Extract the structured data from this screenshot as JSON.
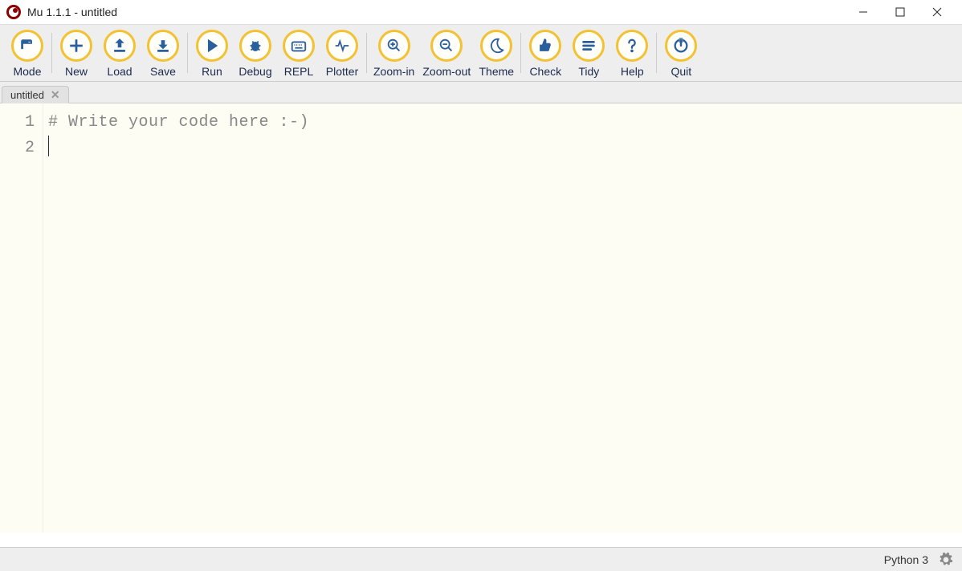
{
  "titlebar": {
    "app_title": "Mu 1.1.1 - untitled"
  },
  "toolbar": {
    "groups": [
      {
        "items": [
          {
            "id": "mode",
            "label": "Mode",
            "icon": "mode-icon"
          }
        ]
      },
      {
        "items": [
          {
            "id": "new",
            "label": "New",
            "icon": "plus-icon"
          },
          {
            "id": "load",
            "label": "Load",
            "icon": "upload-icon"
          },
          {
            "id": "save",
            "label": "Save",
            "icon": "download-icon"
          }
        ]
      },
      {
        "items": [
          {
            "id": "run",
            "label": "Run",
            "icon": "play-icon"
          },
          {
            "id": "debug",
            "label": "Debug",
            "icon": "bug-icon"
          },
          {
            "id": "repl",
            "label": "REPL",
            "icon": "keyboard-icon"
          },
          {
            "id": "plotter",
            "label": "Plotter",
            "icon": "pulse-icon"
          }
        ]
      },
      {
        "items": [
          {
            "id": "zoom-in",
            "label": "Zoom-in",
            "icon": "zoom-in-icon"
          },
          {
            "id": "zoom-out",
            "label": "Zoom-out",
            "icon": "zoom-out-icon"
          },
          {
            "id": "theme",
            "label": "Theme",
            "icon": "moon-icon"
          }
        ]
      },
      {
        "items": [
          {
            "id": "check",
            "label": "Check",
            "icon": "thumb-icon"
          },
          {
            "id": "tidy",
            "label": "Tidy",
            "icon": "lines-icon"
          },
          {
            "id": "help",
            "label": "Help",
            "icon": "question-icon"
          }
        ]
      },
      {
        "items": [
          {
            "id": "quit",
            "label": "Quit",
            "icon": "power-icon"
          }
        ]
      }
    ]
  },
  "tabs": [
    {
      "label": "untitled"
    }
  ],
  "editor": {
    "lines": [
      "# Write your code here :-)",
      ""
    ]
  },
  "statusbar": {
    "mode_label": "Python 3"
  }
}
